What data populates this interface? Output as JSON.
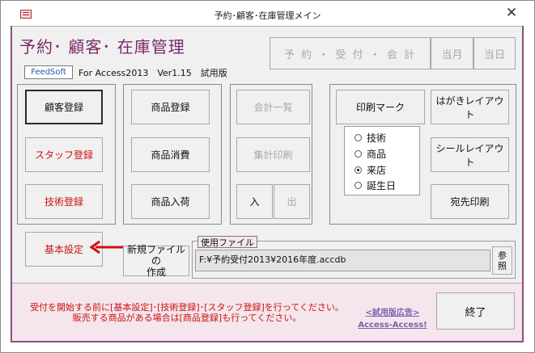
{
  "window": {
    "title": "予約･顧客･在庫管理メイン",
    "app_title": "予約･ 顧客･ 在庫管理"
  },
  "header": {
    "brand_button": "FeedSoft",
    "version_text": "For Access2013　Ver1.15　試用版",
    "reserve_button": "予 約 ・ 受 付 ・ 会 計",
    "this_month_button": "当月",
    "today_button": "当日"
  },
  "left_column": {
    "customer_register": "顧客登録",
    "staff_register": "スタッフ登録",
    "skill_register": "技術登録",
    "basic_settings": "基本設定"
  },
  "product_column": {
    "product_register": "商品登録",
    "product_consume": "商品消費",
    "product_arrival": "商品入荷"
  },
  "accounting_column": {
    "accounting_list": "会計一覧",
    "summary_print": "集計印刷",
    "in_button": "入",
    "out_button": "出"
  },
  "print_panel": {
    "print_mark": "印刷マーク",
    "postcard_layout": "はがきレイアウト",
    "seal_layout": "シールレイアウト",
    "address_print": "宛先印刷",
    "options": [
      {
        "label": "技術",
        "selected": false
      },
      {
        "label": "商品",
        "selected": false
      },
      {
        "label": "来店",
        "selected": true
      },
      {
        "label": "誕生日",
        "selected": false
      }
    ]
  },
  "file_section": {
    "new_file_line1": "新規ファイルの",
    "new_file_line2": "作成",
    "label": "使用ファイル",
    "path": "F:¥予約受付2013¥2016年度.accdb",
    "browse_line1": "参",
    "browse_line2": "照"
  },
  "footer": {
    "notice_line1": "受付を開始する前に[基本設定]･[技術登録]･[スタッフ登録]を行ってください。",
    "notice_line2": "販売する商品がある場合は[商品登録]も行ってください。",
    "ad_line1": "<試用版広告>",
    "ad_line2": "Access-Access!",
    "exit_button": "終了"
  },
  "colors": {
    "title_accent": "#7a2a6a",
    "warning_text": "#cc1111",
    "footer_bg": "#f4e6ec",
    "ad_link": "#7a60b0"
  }
}
